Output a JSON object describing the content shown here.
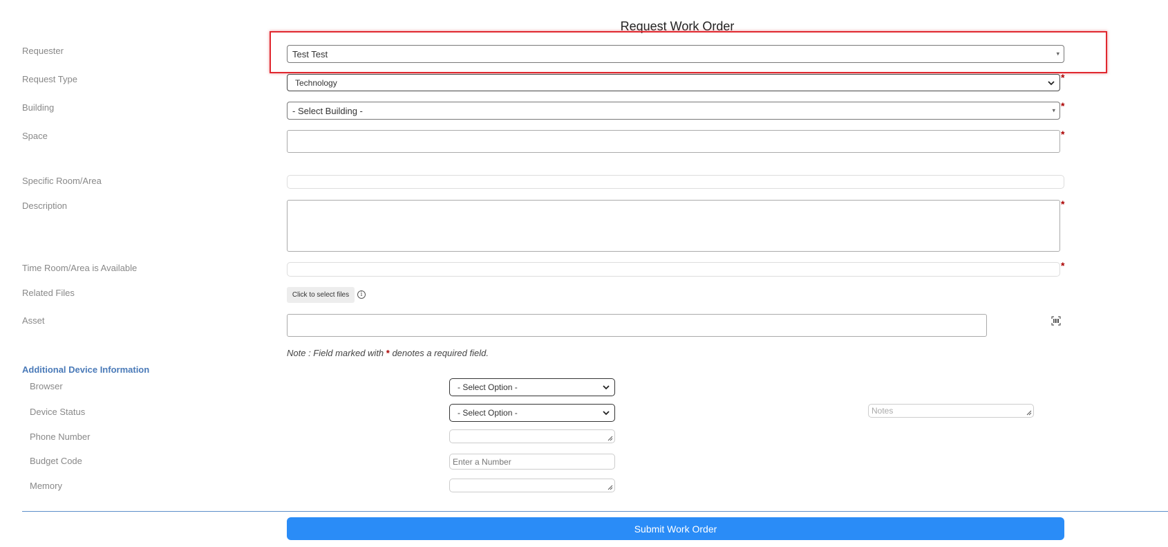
{
  "form": {
    "title": "Request Work Order",
    "required_marker": "*",
    "fields": {
      "requester": {
        "label": "Requester",
        "value": "Test Test"
      },
      "request_type": {
        "label": "Request Type",
        "value": "Technology"
      },
      "building": {
        "label": "Building",
        "value": "- Select Building -"
      },
      "space": {
        "label": "Space"
      },
      "specific_room": {
        "label": "Specific Room/Area"
      },
      "description": {
        "label": "Description"
      },
      "time_available": {
        "label": "Time Room/Area is Available"
      },
      "related_files": {
        "label": "Related Files",
        "button_label": "Click to select files",
        "info_glyph": "i"
      },
      "asset": {
        "label": "Asset"
      }
    },
    "note": {
      "prefix": "Note : Field marked with ",
      "star": "*",
      "suffix": " denotes a required field."
    }
  },
  "additional_device": {
    "heading": "Additional Device Information",
    "browser": {
      "label": "Browser",
      "value": "- Select Option -"
    },
    "device_status": {
      "label": "Device Status",
      "value": "- Select Option -",
      "notes_placeholder": "Notes"
    },
    "phone_number": {
      "label": "Phone Number"
    },
    "budget_code": {
      "label": "Budget Code",
      "placeholder": "Enter a Number"
    },
    "memory": {
      "label": "Memory"
    }
  },
  "submit_label": "Submit Work Order",
  "colors": {
    "accent": "#2a8cf7",
    "highlight": "#e0282f",
    "required": "#aa0000",
    "section_heading": "#4a7ab8"
  }
}
